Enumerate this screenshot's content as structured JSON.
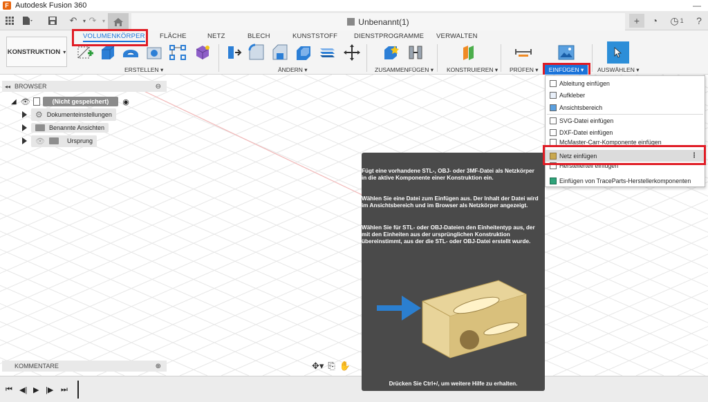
{
  "app": {
    "title": "Autodesk Fusion 360",
    "logo": "F"
  },
  "document": {
    "tab_title": "Unbenannt(1)"
  },
  "quick_access": {
    "notifications_count": "1"
  },
  "ribbon": {
    "workspace": "KONSTRUKTION",
    "tabs": [
      "VOLUMENKÖRPER",
      "FLÄCHE",
      "NETZ",
      "BLECH",
      "KUNSTSTOFF",
      "DIENSTPROGRAMME",
      "VERWALTEN"
    ],
    "active_tab": "VOLUMENKÖRPER",
    "groups": {
      "create": "ERSTELLEN ▾",
      "modify": "ÄNDERN ▾",
      "assemble": "ZUSAMMENFÜGEN ▾",
      "construct": "KONSTRUIEREN ▾",
      "inspect": "PRÜFEN ▾",
      "insert": "EINFÜGEN ▾",
      "select": "AUSWÄHLEN ▾"
    }
  },
  "browser": {
    "header": "BROWSER",
    "root": "(Nicht gespeichert)",
    "items": [
      "Dokumenteinstellungen",
      "Benannte Ansichten",
      "Ursprung"
    ]
  },
  "comments": {
    "header": "KOMMENTARE"
  },
  "insert_menu": {
    "items": [
      "Ableitung einfügen",
      "Aufkleber",
      "Ansichtsbereich",
      "SVG-Datei einfügen",
      "DXF-Datei einfügen",
      "McMaster-Carr-Komponente einfügen",
      "Netz einfügen",
      "Herstellerteil einfügen",
      "Einfügen von TraceParts-Herstellerkomponenten"
    ],
    "highlighted": "Netz einfügen",
    "more_icon": "⋮"
  },
  "tooltip": {
    "para1": "Fügt eine vorhandene STL-, OBJ- oder 3MF-Datei als Netzkörper in die aktive Komponente einer Konstruktion ein.",
    "para2": "Wählen Sie eine Datei zum Einfügen aus. Der Inhalt der Datei wird im Ansichtsbereich und im Browser als Netzkörper angezeigt.",
    "para3": "Wählen Sie für STL- oder OBJ-Dateien den Einheitentyp aus, der mit den Einheiten aus der ursprünglichen Konstruktion übereinstimmt, aus der die STL- oder OBJ-Datei erstellt wurde.",
    "hint": "Drücken Sie Ctrl+/, um weitere Hilfe zu erhalten."
  },
  "colors": {
    "accent": "#1a73d9",
    "highlight": "#e01b24",
    "tooltip_bg": "#4a4a4a",
    "mesh_part": "#e8d49a",
    "arrow": "#2b7fd0"
  }
}
